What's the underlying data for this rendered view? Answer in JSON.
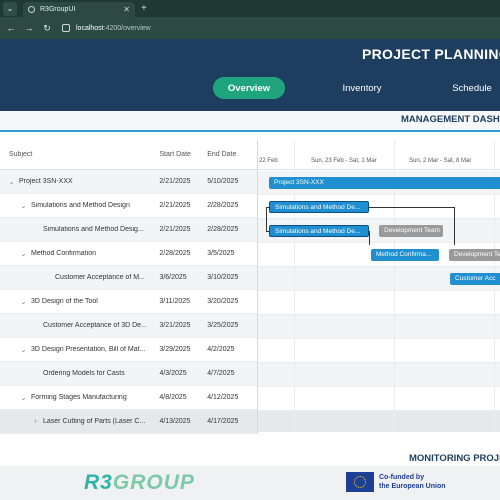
{
  "browser": {
    "tab_title": "R3GroupUI",
    "new_tab_symbol": "+",
    "url_host": "localhost",
    "url_path": ":4200/overview"
  },
  "app": {
    "title": "PROJECT PLANNING S",
    "nav_tabs": [
      {
        "label": "Overview",
        "active": true
      },
      {
        "label": "Inventory",
        "active": false
      },
      {
        "label": "Schedule",
        "active": false
      }
    ],
    "section_title": "MANAGEMENT DASHB",
    "accent_color": "#1fa47d",
    "header_color": "#1d3e5e"
  },
  "grid": {
    "columns": [
      "Subject",
      "Start Date",
      "End Date"
    ],
    "rows": [
      {
        "subject": "Project 3SN-XXX",
        "start": "2/21/2025",
        "end": "5/10/2025",
        "level": 0,
        "expandable": true
      },
      {
        "subject": "Simulations and Method Design",
        "start": "2/21/2025",
        "end": "2/28/2025",
        "level": 1,
        "expandable": true
      },
      {
        "subject": "Simulations and Method Desig...",
        "start": "2/21/2025",
        "end": "2/28/2025",
        "level": 2,
        "expandable": false
      },
      {
        "subject": "Method Confirmation",
        "start": "2/28/2025",
        "end": "3/5/2025",
        "level": 1,
        "expandable": true
      },
      {
        "subject": "Customer Acceptance of M...",
        "start": "3/6/2025",
        "end": "3/10/2025",
        "level": 3,
        "expandable": false
      },
      {
        "subject": "3D Design of the Tool",
        "start": "3/11/2025",
        "end": "3/20/2025",
        "level": 1,
        "expandable": true
      },
      {
        "subject": "Customer Acceptance of 3D De...",
        "start": "3/21/2025",
        "end": "3/25/2025",
        "level": 2,
        "expandable": false
      },
      {
        "subject": "3D Design Presentation, Bill of Mat...",
        "start": "3/29/2025",
        "end": "4/2/2025",
        "level": 1,
        "expandable": true
      },
      {
        "subject": "Ordering Models for Casts",
        "start": "4/3/2025",
        "end": "4/7/2025",
        "level": 2,
        "expandable": false
      },
      {
        "subject": "Forming Stages Manufacturing",
        "start": "4/8/2025",
        "end": "4/12/2025",
        "level": 1,
        "expandable": true
      },
      {
        "subject": "Laser Cutting of Parts (Laser C...",
        "start": "4/13/2025",
        "end": "4/17/2025",
        "level": 2,
        "expandable": true
      }
    ]
  },
  "timeline": {
    "weeks": [
      "22 Feb",
      "Sun, 23 Feb - Sat, 1 Mar",
      "Sun, 2 Mar - Sat, 8 Mar"
    ],
    "bars": [
      {
        "label": "Project 3SN-XXX",
        "row": 0,
        "style": "blue"
      },
      {
        "label": "Simulations and Method De...",
        "row": 1,
        "style": "sel"
      },
      {
        "label": "Simulations and Method De...",
        "row": 2,
        "style": "sel"
      },
      {
        "label": "Development Team",
        "row": 2,
        "style": "grey"
      },
      {
        "label": "Method Confirma...",
        "row": 3,
        "style": "blue"
      },
      {
        "label": "Development Te",
        "row": 3,
        "style": "grey"
      },
      {
        "label": "Customer Acc",
        "row": 4,
        "style": "blue"
      }
    ]
  },
  "footer": {
    "monitoring_title": "MONITORING PROJE",
    "logo_text_a": "R3",
    "logo_text_b": "GROUP",
    "eu_line1": "Co-funded by",
    "eu_line2": "the European Union"
  }
}
